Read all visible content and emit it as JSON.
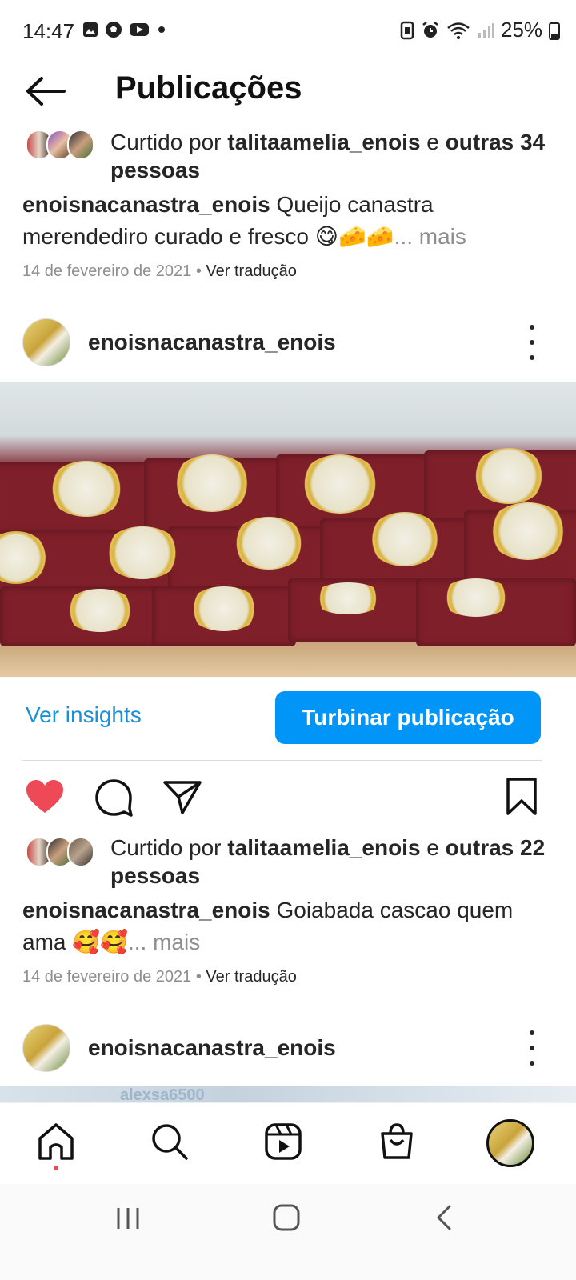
{
  "status_bar": {
    "time": "14:47",
    "left_icons": [
      "gallery-icon",
      "soccer-icon",
      "youtube-icon",
      "dot-icon"
    ],
    "right_icons": [
      "vibrate-icon",
      "alarm-icon",
      "wifi-icon",
      "signal-icon",
      "battery-icon"
    ],
    "battery": "25%"
  },
  "header": {
    "title": "Publicações"
  },
  "post1_footer": {
    "liked_prefix": "Curtido por ",
    "liked_user": "talitaamelia_enois",
    "liked_and": " e ",
    "liked_others": "outras 34 pessoas",
    "caption_user": "enoisnacanastra_enois",
    "caption_text": " Queijo canastra merendediro curado e fresco 😋🧀🧀",
    "more": "... mais",
    "date": "14 de fevereiro de 2021",
    "separator": " • ",
    "translate": "Ver tradução"
  },
  "post2": {
    "username": "enoisnacanastra_enois",
    "insights": "Ver insights",
    "boost": "Turbinar publicação",
    "liked_prefix": "Curtido por ",
    "liked_user": "talitaamelia_enois",
    "liked_and": " e ",
    "liked_others": "outras 22 pessoas",
    "caption_user": "enoisnacanastra_enois",
    "caption_text": " Goiabada cascao quem ama 🥰🥰",
    "more": "... mais",
    "date": "14 de fevereiro de 2021",
    "separator": " • ",
    "translate": "Ver tradução",
    "liked": true
  },
  "post3": {
    "username": "enoisnacanastra_enois",
    "peek_text": "alexsa6500"
  },
  "colors": {
    "accent": "#0095f6",
    "like": "#ed4956",
    "link": "#1a8fd9"
  },
  "bottom_nav": [
    "home-icon",
    "search-icon",
    "reels-icon",
    "shop-icon",
    "profile-avatar"
  ],
  "system_nav": [
    "recents-icon",
    "home-circle-icon",
    "back-chevron-icon"
  ]
}
